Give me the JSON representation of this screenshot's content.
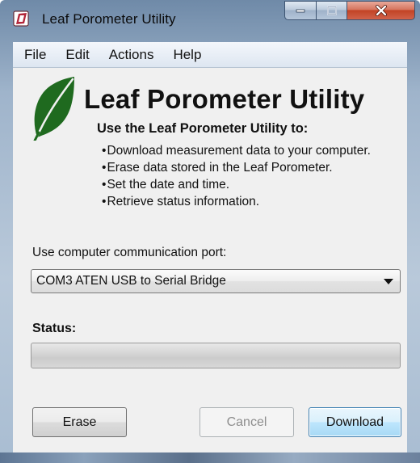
{
  "window": {
    "title": "Leaf Porometer Utility"
  },
  "menu": {
    "items": [
      "File",
      "Edit",
      "Actions",
      "Help"
    ]
  },
  "header": {
    "product_title": "Leaf Porometer Utility",
    "subtitle": "Use the Leaf Porometer Utility to:",
    "bullets": [
      "Download measurement data to your computer.",
      "Erase data stored in the Leaf Porometer.",
      "Set the date and time.",
      "Retrieve status information."
    ]
  },
  "port": {
    "label": "Use computer communication port:",
    "selected": "COM3 ATEN USB to Serial Bridge"
  },
  "status": {
    "label": "Status:",
    "progress": 0
  },
  "buttons": {
    "erase": "Erase",
    "cancel": "Cancel",
    "download": "Download"
  },
  "colors": {
    "leaf_green": "#1f6a1f",
    "app_icon_red": "#b3263a",
    "download_border": "#3c7fb1"
  },
  "icons": {
    "app": "app-icon",
    "logo": "leaf-logo-icon",
    "minimize": "minimize-icon",
    "maximize": "maximize-icon",
    "close": "close-icon",
    "dropdown": "chevron-down-icon"
  }
}
